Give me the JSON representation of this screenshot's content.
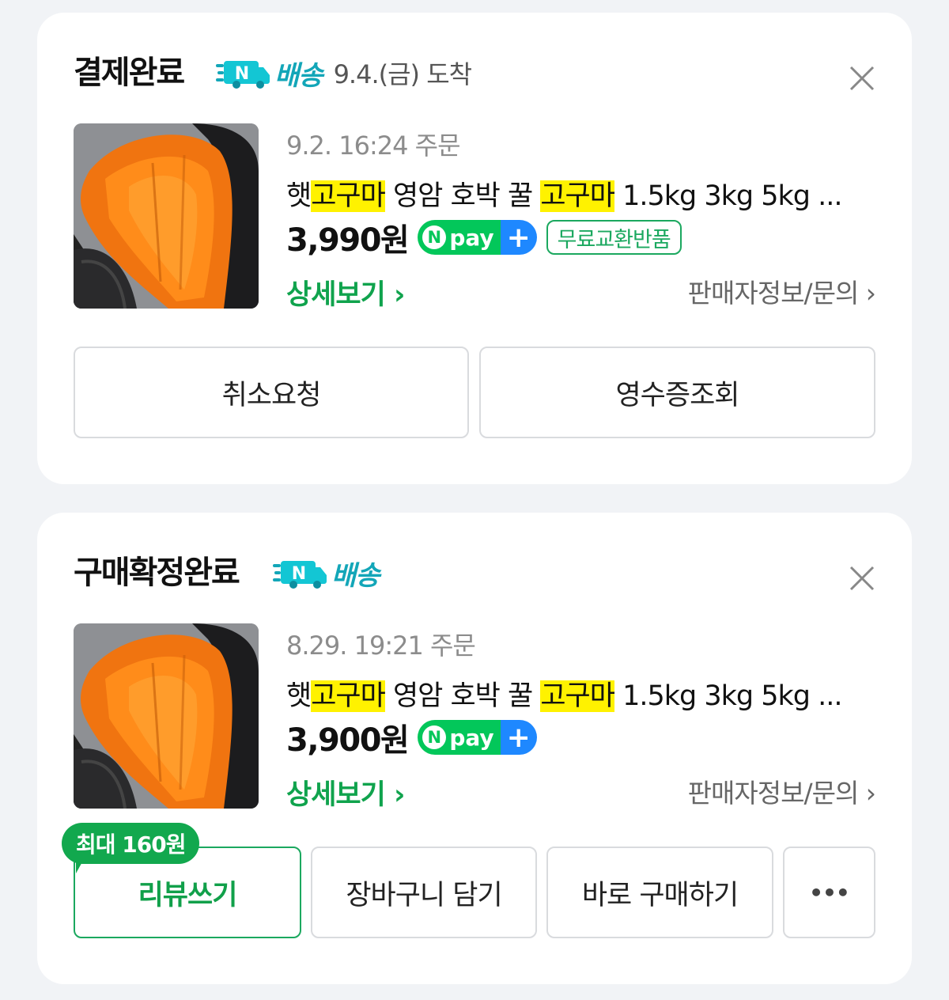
{
  "orders": [
    {
      "status": "결제완료",
      "ship_label": "배송",
      "arrival": "9.4.(금) 도착",
      "order_date": "9.2. 16:24 주문",
      "title": {
        "p1": "햇",
        "h1": "고구마",
        "p2": " 영암 호박 꿀 ",
        "h2": "고구마",
        "p3": " 1.5kg 3kg 5kg ..."
      },
      "price": "3,990원",
      "npay": "pay",
      "npay_n": "N",
      "free_badge": "무료교환반품",
      "detail": "상세보기 ›",
      "seller": "판매자정보/문의 ›",
      "buttons": [
        "취소요청",
        "영수증조회"
      ]
    },
    {
      "status": "구매확정완료",
      "ship_label": "배송",
      "order_date": "8.29. 19:21 주문",
      "title": {
        "p1": "햇",
        "h1": "고구마",
        "p2": " 영암 호박 꿀 ",
        "h2": "고구마",
        "p3": " 1.5kg 3kg 5kg ..."
      },
      "price": "3,900원",
      "npay": "pay",
      "npay_n": "N",
      "detail": "상세보기 ›",
      "seller": "판매자정보/문의 ›",
      "review_bubble": "최대 160원",
      "buttons": [
        "리뷰쓰기",
        "장바구니 담기",
        "바로 구매하기",
        "•••"
      ]
    }
  ],
  "colors": {
    "naver_green": "#03c75a",
    "highlight": "#fff200",
    "npay_blue": "#1e88ff",
    "ship_teal": "#13a6b8"
  }
}
